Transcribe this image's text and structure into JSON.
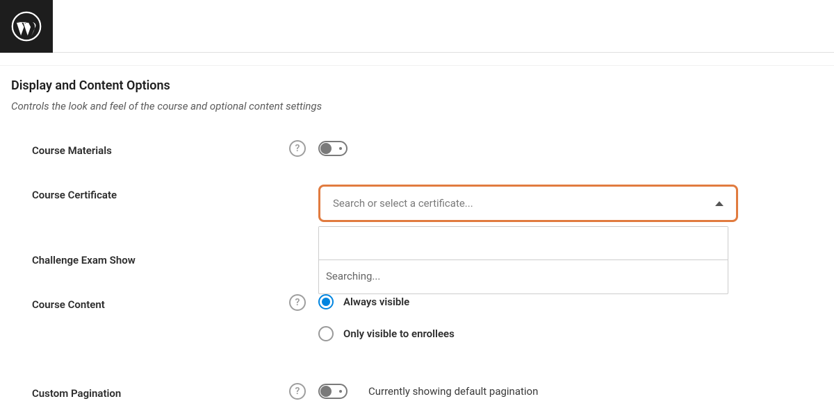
{
  "section": {
    "title": "Display and Content Options",
    "description": "Controls the look and feel of the course and optional content settings"
  },
  "fields": {
    "course_materials": {
      "label": "Course Materials"
    },
    "course_certificate": {
      "label": "Course Certificate",
      "placeholder": "Search or select a certificate...",
      "search_status": "Searching..."
    },
    "challenge_exam": {
      "label": "Challenge Exam Show"
    },
    "course_content": {
      "label": "Course Content",
      "options": [
        {
          "label": "Always visible",
          "selected": true
        },
        {
          "label": "Only visible to enrollees",
          "selected": false
        }
      ]
    },
    "custom_pagination": {
      "label": "Custom Pagination",
      "status": "Currently showing default pagination"
    }
  }
}
